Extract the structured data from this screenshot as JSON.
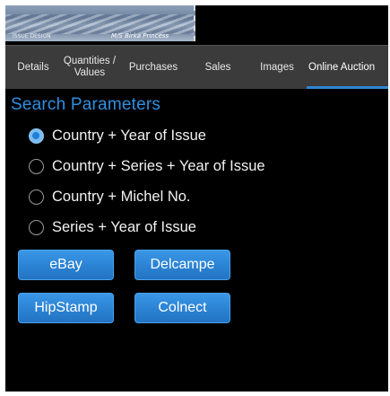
{
  "banner": {
    "caption_left": "ISSUE DESIGN",
    "caption_right": "M/S Birka Princess"
  },
  "tabs": [
    {
      "label": "Details",
      "active": false
    },
    {
      "label": "Quantities / Values",
      "active": false
    },
    {
      "label": "Purchases",
      "active": false
    },
    {
      "label": "Sales",
      "active": false
    },
    {
      "label": "Images",
      "active": false
    },
    {
      "label": "Online Auction",
      "active": true
    }
  ],
  "search": {
    "title": "Search Parameters",
    "options": [
      {
        "label": "Country + Year of Issue",
        "selected": true
      },
      {
        "label": "Country + Series + Year of Issue",
        "selected": false
      },
      {
        "label": "Country + Michel No.",
        "selected": false
      },
      {
        "label": "Series + Year of Issue",
        "selected": false
      }
    ]
  },
  "buttons": {
    "ebay": "eBay",
    "delcampe": "Delcampe",
    "hipstamp": "HipStamp",
    "colnect": "Colnect"
  },
  "colors": {
    "accent": "#2f8fe0",
    "button": "#2b82d3",
    "tabbar": "#3b3b3b",
    "background": "#000000"
  }
}
